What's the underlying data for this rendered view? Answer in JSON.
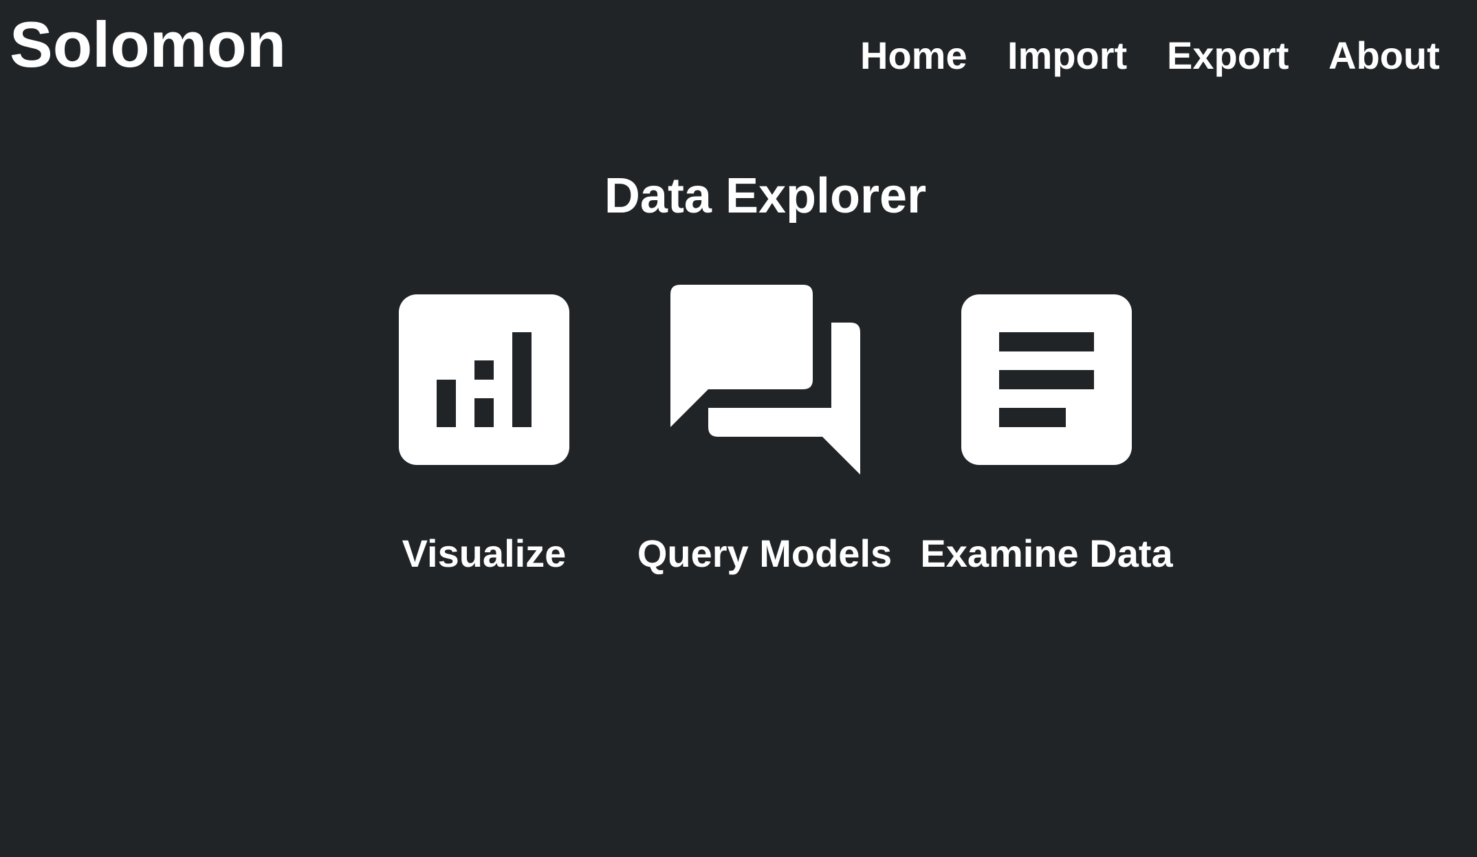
{
  "app": {
    "title": "Solomon"
  },
  "nav": {
    "items": [
      {
        "label": "Home"
      },
      {
        "label": "Import"
      },
      {
        "label": "Export"
      },
      {
        "label": "About"
      }
    ]
  },
  "main": {
    "title": "Data Explorer",
    "cards": [
      {
        "label": "Visualize",
        "icon": "bar-chart-icon"
      },
      {
        "label": "Query Models",
        "icon": "chat-bubbles-icon"
      },
      {
        "label": "Examine Data",
        "icon": "document-icon"
      }
    ]
  },
  "colors": {
    "background": "#202427",
    "foreground": "#ffffff"
  }
}
